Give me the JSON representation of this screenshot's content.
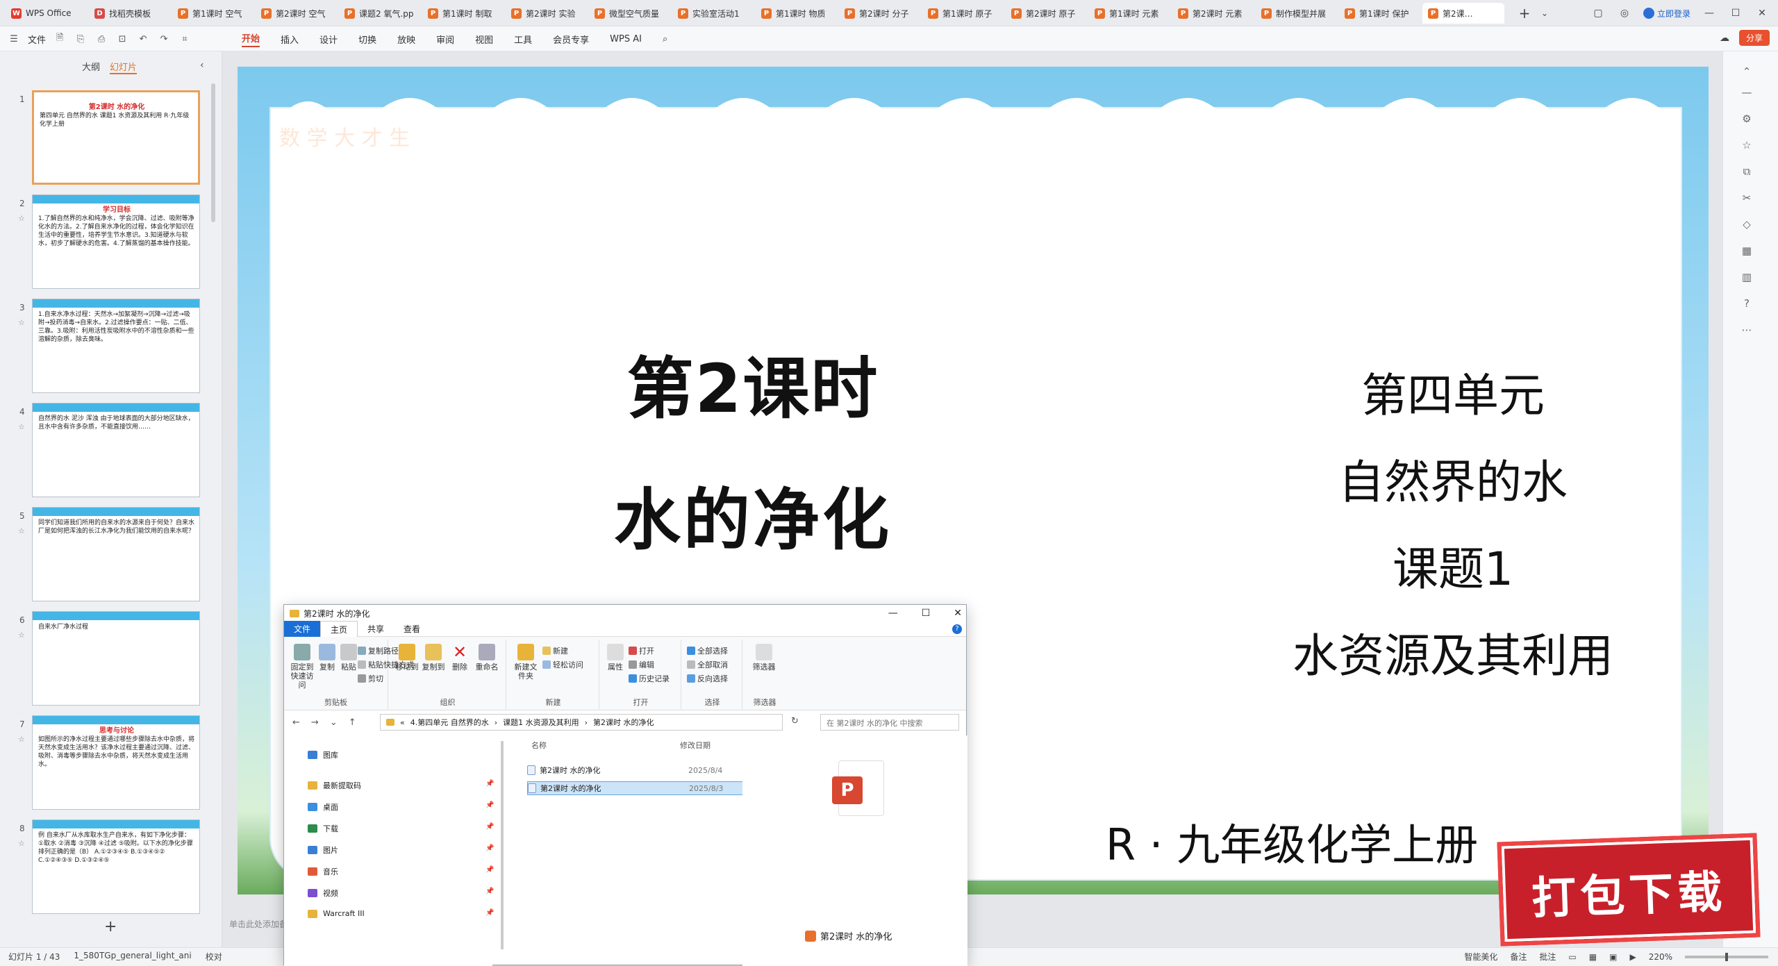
{
  "tabs": [
    {
      "label": "WPS Office",
      "icon": "w"
    },
    {
      "label": "找稻壳模板",
      "icon": "d"
    },
    {
      "label": "第1课时 空气",
      "icon": "p"
    },
    {
      "label": "第2课时 空气",
      "icon": "p"
    },
    {
      "label": "课题2 氧气.pp",
      "icon": "p"
    },
    {
      "label": "第1课时 制取",
      "icon": "p"
    },
    {
      "label": "第2课时 实验",
      "icon": "p"
    },
    {
      "label": "微型空气质量",
      "icon": "p"
    },
    {
      "label": "实验室活动1",
      "icon": "p"
    },
    {
      "label": "第1课时 物质",
      "icon": "p"
    },
    {
      "label": "第2课时 分子",
      "icon": "p"
    },
    {
      "label": "第1课时 原子",
      "icon": "p"
    },
    {
      "label": "第2课时 原子",
      "icon": "p"
    },
    {
      "label": "第1课时 元素",
      "icon": "p"
    },
    {
      "label": "第2课时 元素",
      "icon": "p"
    },
    {
      "label": "制作模型并展",
      "icon": "p"
    },
    {
      "label": "第1课时 保护",
      "icon": "p"
    },
    {
      "label": "第2课…",
      "icon": "p",
      "active": true
    }
  ],
  "tab_add": "+",
  "tab_more": "⌄",
  "login": "立即登录",
  "window": {
    "min": "—",
    "max": "☐",
    "close": "✕"
  },
  "ribbon": {
    "file": "文件",
    "tabs": [
      "开始",
      "插入",
      "设计",
      "切换",
      "放映",
      "审阅",
      "视图",
      "工具",
      "会员专享"
    ],
    "wps_ai": "WPS AI",
    "share": "分享"
  },
  "left_panel": {
    "outline": "大纲",
    "slides": "幻灯片",
    "add": "+",
    "thumbs": [
      {
        "num": "1",
        "title": "第2课时 水的净化",
        "body": "第四单元 自然界的水 课题1 水资源及其利用  R·九年级化学上册"
      },
      {
        "num": "2",
        "title": "学习目标",
        "body": "1.了解自然界的水和纯净水，学会沉降、过滤、吸附等净化水的方法。2.了解自来水净化的过程，体会化学知识在生活中的重要性，培养学生节水意识。3.知道硬水与软水，初步了解硬水的危害。4.了解蒸馏的基本操作技能。"
      },
      {
        "num": "3",
        "title": "",
        "body": "1.自来水净水过程：天然水→加絮凝剂→沉降→过滤→吸附→投药消毒→自来水。2.过滤操作要点：一贴、二低、三靠。3.吸附：利用活性炭吸附水中的不溶性杂质和一些溶解的杂质，除去臭味。"
      },
      {
        "num": "4",
        "title": "",
        "body": "自然界的水 泥沙 浑浊 由于地球表面的大部分地区缺水，且水中含有许多杂质，不能直接饮用……"
      },
      {
        "num": "5",
        "title": "",
        "body": "同学们知道我们所用的自来水的水源来自于何处？自来水厂是如何把浑浊的长江水净化为我们能饮用的自来水呢？"
      },
      {
        "num": "6",
        "title": "",
        "body": "自来水厂净水过程"
      },
      {
        "num": "7",
        "title": "思考与讨论",
        "body": "如图所示的净水过程主要通过哪些步骤除去水中杂质，将天然水变成生活用水？该净水过程主要通过沉降、过滤、吸附、消毒等步骤除去水中杂质，将天然水变成生活用水。"
      },
      {
        "num": "8",
        "title": "",
        "body": "例 自来水厂从水库取水生产自来水，有如下净化步骤：①取水 ②消毒 ③沉降 ④过滤 ⑤吸附。以下水的净化步骤排列正确的是（B） A.①②③④⑤ B.①③④⑤② C.①②④③⑤ D.①③②④⑤"
      }
    ]
  },
  "slide": {
    "watermark": "数  学  大  才  生",
    "title_line1": "第2课时",
    "title_line2": "水的净化",
    "right_lines": [
      "第四单元",
      "自然界的水",
      "课题1",
      "水资源及其利用"
    ],
    "subtitle": "R · 九年级化学上册",
    "notes_placeholder": "单击此处添加备注"
  },
  "status": {
    "slide_count": "幻灯片 1 / 43",
    "template": "1_580TGp_general_light_ani",
    "proof": "校对",
    "smart": "智能美化",
    "notes": "备注",
    "comments": "批注",
    "zoom": "220%"
  },
  "explorer": {
    "title": "第2课时 水的净化",
    "menu": {
      "file": "文件",
      "home": "主页",
      "share": "共享",
      "view": "查看"
    },
    "help": "?",
    "groups": {
      "clipboard": {
        "label": "剪贴板",
        "pin": "固定到快速访问",
        "copy": "复制",
        "paste": "粘贴",
        "copy_path": "复制路径",
        "paste_shortcut": "粘贴快捷方式",
        "cut": "剪切"
      },
      "organize": {
        "label": "组织",
        "move_to": "移动到",
        "copy_to": "复制到",
        "delete": "删除",
        "rename": "重命名"
      },
      "new": {
        "label": "新建",
        "new_folder": "新建文件夹",
        "new_item": "新建",
        "easy_access": "轻松访问"
      },
      "open": {
        "label": "打开",
        "properties": "属性",
        "open": "打开",
        "edit": "编辑",
        "history": "历史记录"
      },
      "select": {
        "label": "选择",
        "select_all": "全部选择",
        "select_none": "全部取消",
        "invert": "反向选择"
      },
      "filter": {
        "label": "筛选器",
        "filter_btn": "筛选器"
      }
    },
    "path": [
      "«",
      "4.第四单元 自然界的水",
      "›",
      "课题1 水资源及其利用",
      "›",
      "第2课时 水的净化"
    ],
    "search_placeholder": "在 第2课时 水的净化 中搜索",
    "sidebar": [
      {
        "name": "图库",
        "color": "#3a7fd4"
      },
      {
        "name": "最新提取码",
        "color": "#e8b339"
      },
      {
        "name": "桌面",
        "color": "#3a8fe0"
      },
      {
        "name": "下载",
        "color": "#2d8c4b"
      },
      {
        "name": "图片",
        "color": "#3a7fd4"
      },
      {
        "name": "音乐",
        "color": "#e05a3a"
      },
      {
        "name": "视频",
        "color": "#7a4fd0"
      },
      {
        "name": "Warcraft III",
        "color": "#e8b339"
      }
    ],
    "columns": {
      "name": "名称",
      "date": "修改日期"
    },
    "files": [
      {
        "name": "第2课时 水的净化",
        "date": "2025/8/4"
      },
      {
        "name": "第2课时 水的净化",
        "date": "2025/8/3",
        "selected": true
      }
    ],
    "preview_name": "第2课时 水的净化",
    "preview_icon_letter": "P"
  },
  "stamp": "打包下载"
}
